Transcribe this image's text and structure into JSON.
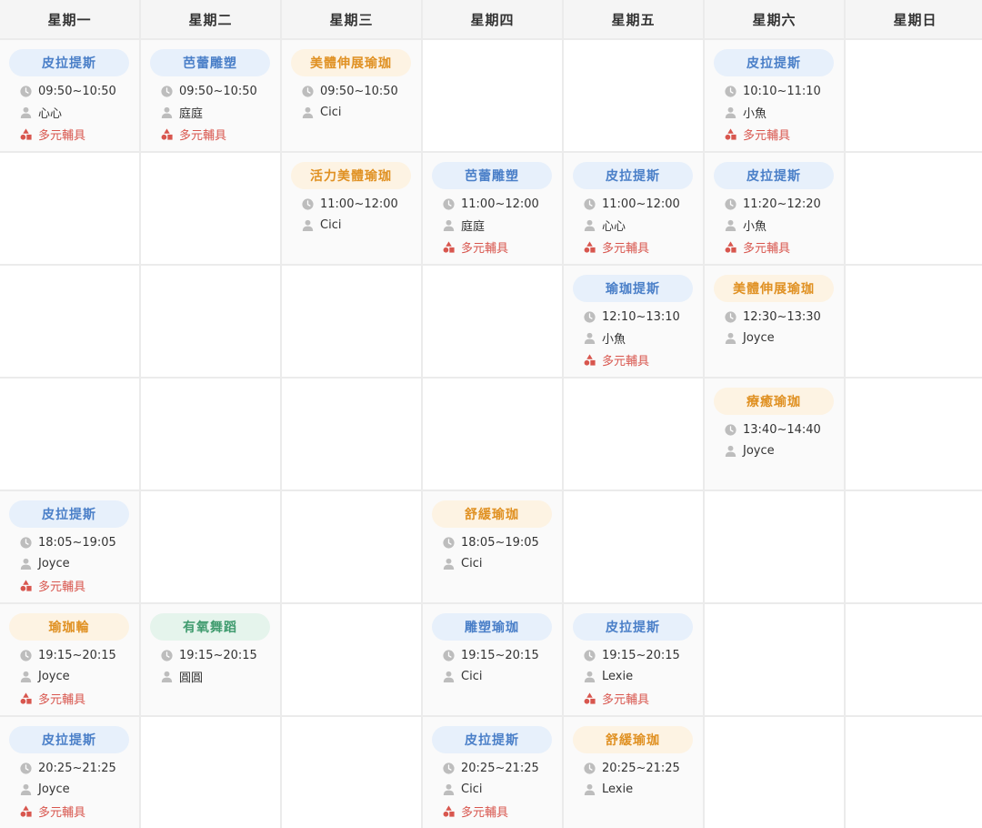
{
  "colors": {
    "pilates": {
      "bg": "#e7f0fb",
      "fg": "#4a7fc8"
    },
    "ballet": {
      "bg": "#e7f0fb",
      "fg": "#4a7fc8"
    },
    "yoga": {
      "bg": "#fdf3e3",
      "fg": "#e09123"
    },
    "aerobic": {
      "bg": "#e5f4ec",
      "fg": "#3f9b6e"
    },
    "equipment": "#d8564e",
    "icon": "#bdbdbd"
  },
  "days": [
    "星期一",
    "星期二",
    "星期三",
    "星期四",
    "星期五",
    "星期六",
    "星期日"
  ],
  "rows": [
    [
      {
        "name": "皮拉提斯",
        "theme": "pilates",
        "time": "09:50~10:50",
        "teacher": "心心",
        "equipment": "多元輔具"
      },
      {
        "name": "芭蕾雕塑",
        "theme": "ballet",
        "time": "09:50~10:50",
        "teacher": "庭庭",
        "equipment": "多元輔具"
      },
      {
        "name": "美體伸展瑜珈",
        "theme": "yoga",
        "time": "09:50~10:50",
        "teacher": "Cici"
      },
      null,
      null,
      {
        "name": "皮拉提斯",
        "theme": "pilates",
        "time": "10:10~11:10",
        "teacher": "小魚",
        "equipment": "多元輔具"
      },
      null
    ],
    [
      null,
      null,
      {
        "name": "活力美體瑜珈",
        "theme": "yoga",
        "time": "11:00~12:00",
        "teacher": "Cici"
      },
      {
        "name": "芭蕾雕塑",
        "theme": "ballet",
        "time": "11:00~12:00",
        "teacher": "庭庭",
        "equipment": "多元輔具"
      },
      {
        "name": "皮拉提斯",
        "theme": "pilates",
        "time": "11:00~12:00",
        "teacher": "心心",
        "equipment": "多元輔具"
      },
      {
        "name": "皮拉提斯",
        "theme": "pilates",
        "time": "11:20~12:20",
        "teacher": "小魚",
        "equipment": "多元輔具"
      },
      null
    ],
    [
      null,
      null,
      null,
      null,
      {
        "name": "瑜珈提斯",
        "theme": "pilates",
        "time": "12:10~13:10",
        "teacher": "小魚",
        "equipment": "多元輔具"
      },
      {
        "name": "美體伸展瑜珈",
        "theme": "yoga",
        "time": "12:30~13:30",
        "teacher": "Joyce"
      },
      null
    ],
    [
      null,
      null,
      null,
      null,
      null,
      {
        "name": "療癒瑜珈",
        "theme": "yoga",
        "time": "13:40~14:40",
        "teacher": "Joyce"
      },
      null
    ],
    [
      {
        "name": "皮拉提斯",
        "theme": "pilates",
        "time": "18:05~19:05",
        "teacher": "Joyce",
        "equipment": "多元輔具"
      },
      null,
      null,
      {
        "name": "舒緩瑜珈",
        "theme": "yoga",
        "time": "18:05~19:05",
        "teacher": "Cici"
      },
      null,
      null,
      null
    ],
    [
      {
        "name": "瑜珈輪",
        "theme": "yoga",
        "time": "19:15~20:15",
        "teacher": "Joyce",
        "equipment": "多元輔具"
      },
      {
        "name": "有氧舞蹈",
        "theme": "aerobic",
        "time": "19:15~20:15",
        "teacher": "圓圓"
      },
      null,
      {
        "name": "雕塑瑜珈",
        "theme": "pilates",
        "time": "19:15~20:15",
        "teacher": "Cici"
      },
      {
        "name": "皮拉提斯",
        "theme": "pilates",
        "time": "19:15~20:15",
        "teacher": "Lexie",
        "equipment": "多元輔具"
      },
      null,
      null
    ],
    [
      {
        "name": "皮拉提斯",
        "theme": "pilates",
        "time": "20:25~21:25",
        "teacher": "Joyce",
        "equipment": "多元輔具"
      },
      null,
      null,
      {
        "name": "皮拉提斯",
        "theme": "pilates",
        "time": "20:25~21:25",
        "teacher": "Cici",
        "equipment": "多元輔具"
      },
      {
        "name": "舒緩瑜珈",
        "theme": "yoga",
        "time": "20:25~21:25",
        "teacher": "Lexie"
      },
      null,
      null
    ]
  ]
}
